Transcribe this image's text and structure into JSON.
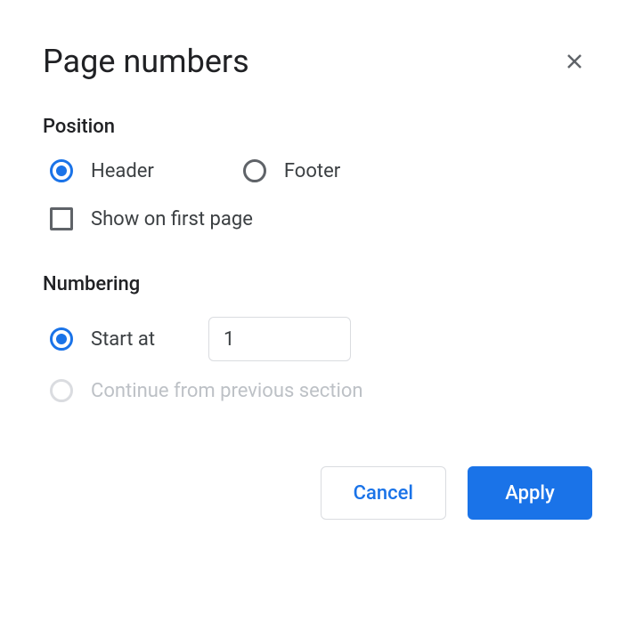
{
  "dialog": {
    "title": "Page numbers"
  },
  "position": {
    "section_label": "Position",
    "header_label": "Header",
    "footer_label": "Footer",
    "show_first_page_label": "Show on first page"
  },
  "numbering": {
    "section_label": "Numbering",
    "start_at_label": "Start at",
    "start_at_value": "1",
    "continue_label": "Continue from previous section"
  },
  "buttons": {
    "cancel": "Cancel",
    "apply": "Apply"
  }
}
